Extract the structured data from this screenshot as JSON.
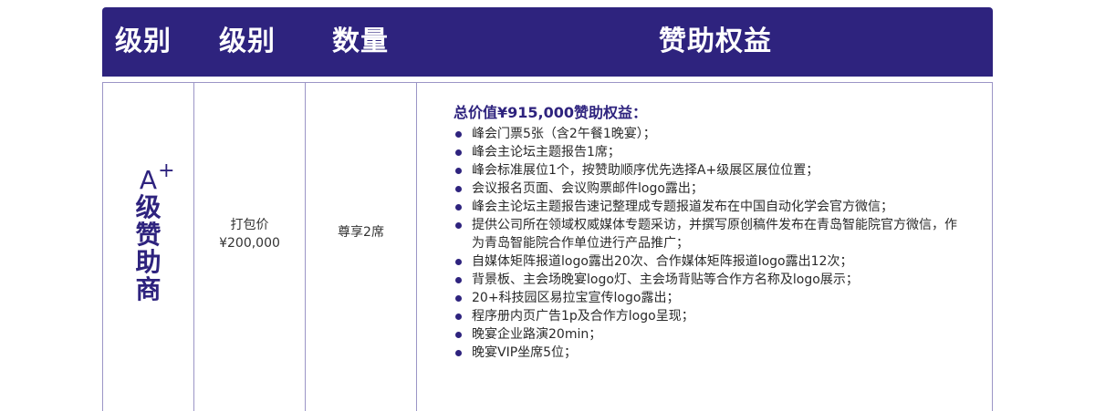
{
  "header": {
    "col1": "级别",
    "col2": "级别",
    "col3": "数量",
    "col4": "赞助权益"
  },
  "row": {
    "level_main": "A",
    "level_sup": "+",
    "level_chars": [
      "级",
      "赞",
      "助",
      "商"
    ],
    "price_label": "打包价",
    "price_value": "¥200,000",
    "quantity": "尊享2席",
    "benefits_title": "总价值¥915,000赞助权益：",
    "benefits": [
      "峰会门票5张（含2午餐1晚宴）；",
      "峰会主论坛主题报告1席；",
      "峰会标准展位1个，按赞助顺序优先选择A+级展区展位位置；",
      "会议报名页面、会议购票邮件logo露出；",
      "峰会主论坛主题报告速记整理成专题报道发布在中国自动化学会官方微信；",
      "提供公司所在领域权威媒体专题采访，并撰写原创稿件发布在青岛智能院官方微信，作为青岛智能院合作单位进行产品推广；",
      "自媒体矩阵报道logo露出20次、合作媒体矩阵报道logo露出12次；",
      "背景板、主会场晚宴logo灯、主会场背贴等合作方名称及logo展示；",
      "20+科技园区易拉宝宣传logo露出；",
      "程序册内页广告1p及合作方logo呈现；",
      "晚宴企业路演20min；",
      "晚宴VIP坐席5位；"
    ]
  },
  "colors": {
    "header_bg": "#2e237e",
    "accent": "#2e237e",
    "border": "#9b95c6"
  }
}
